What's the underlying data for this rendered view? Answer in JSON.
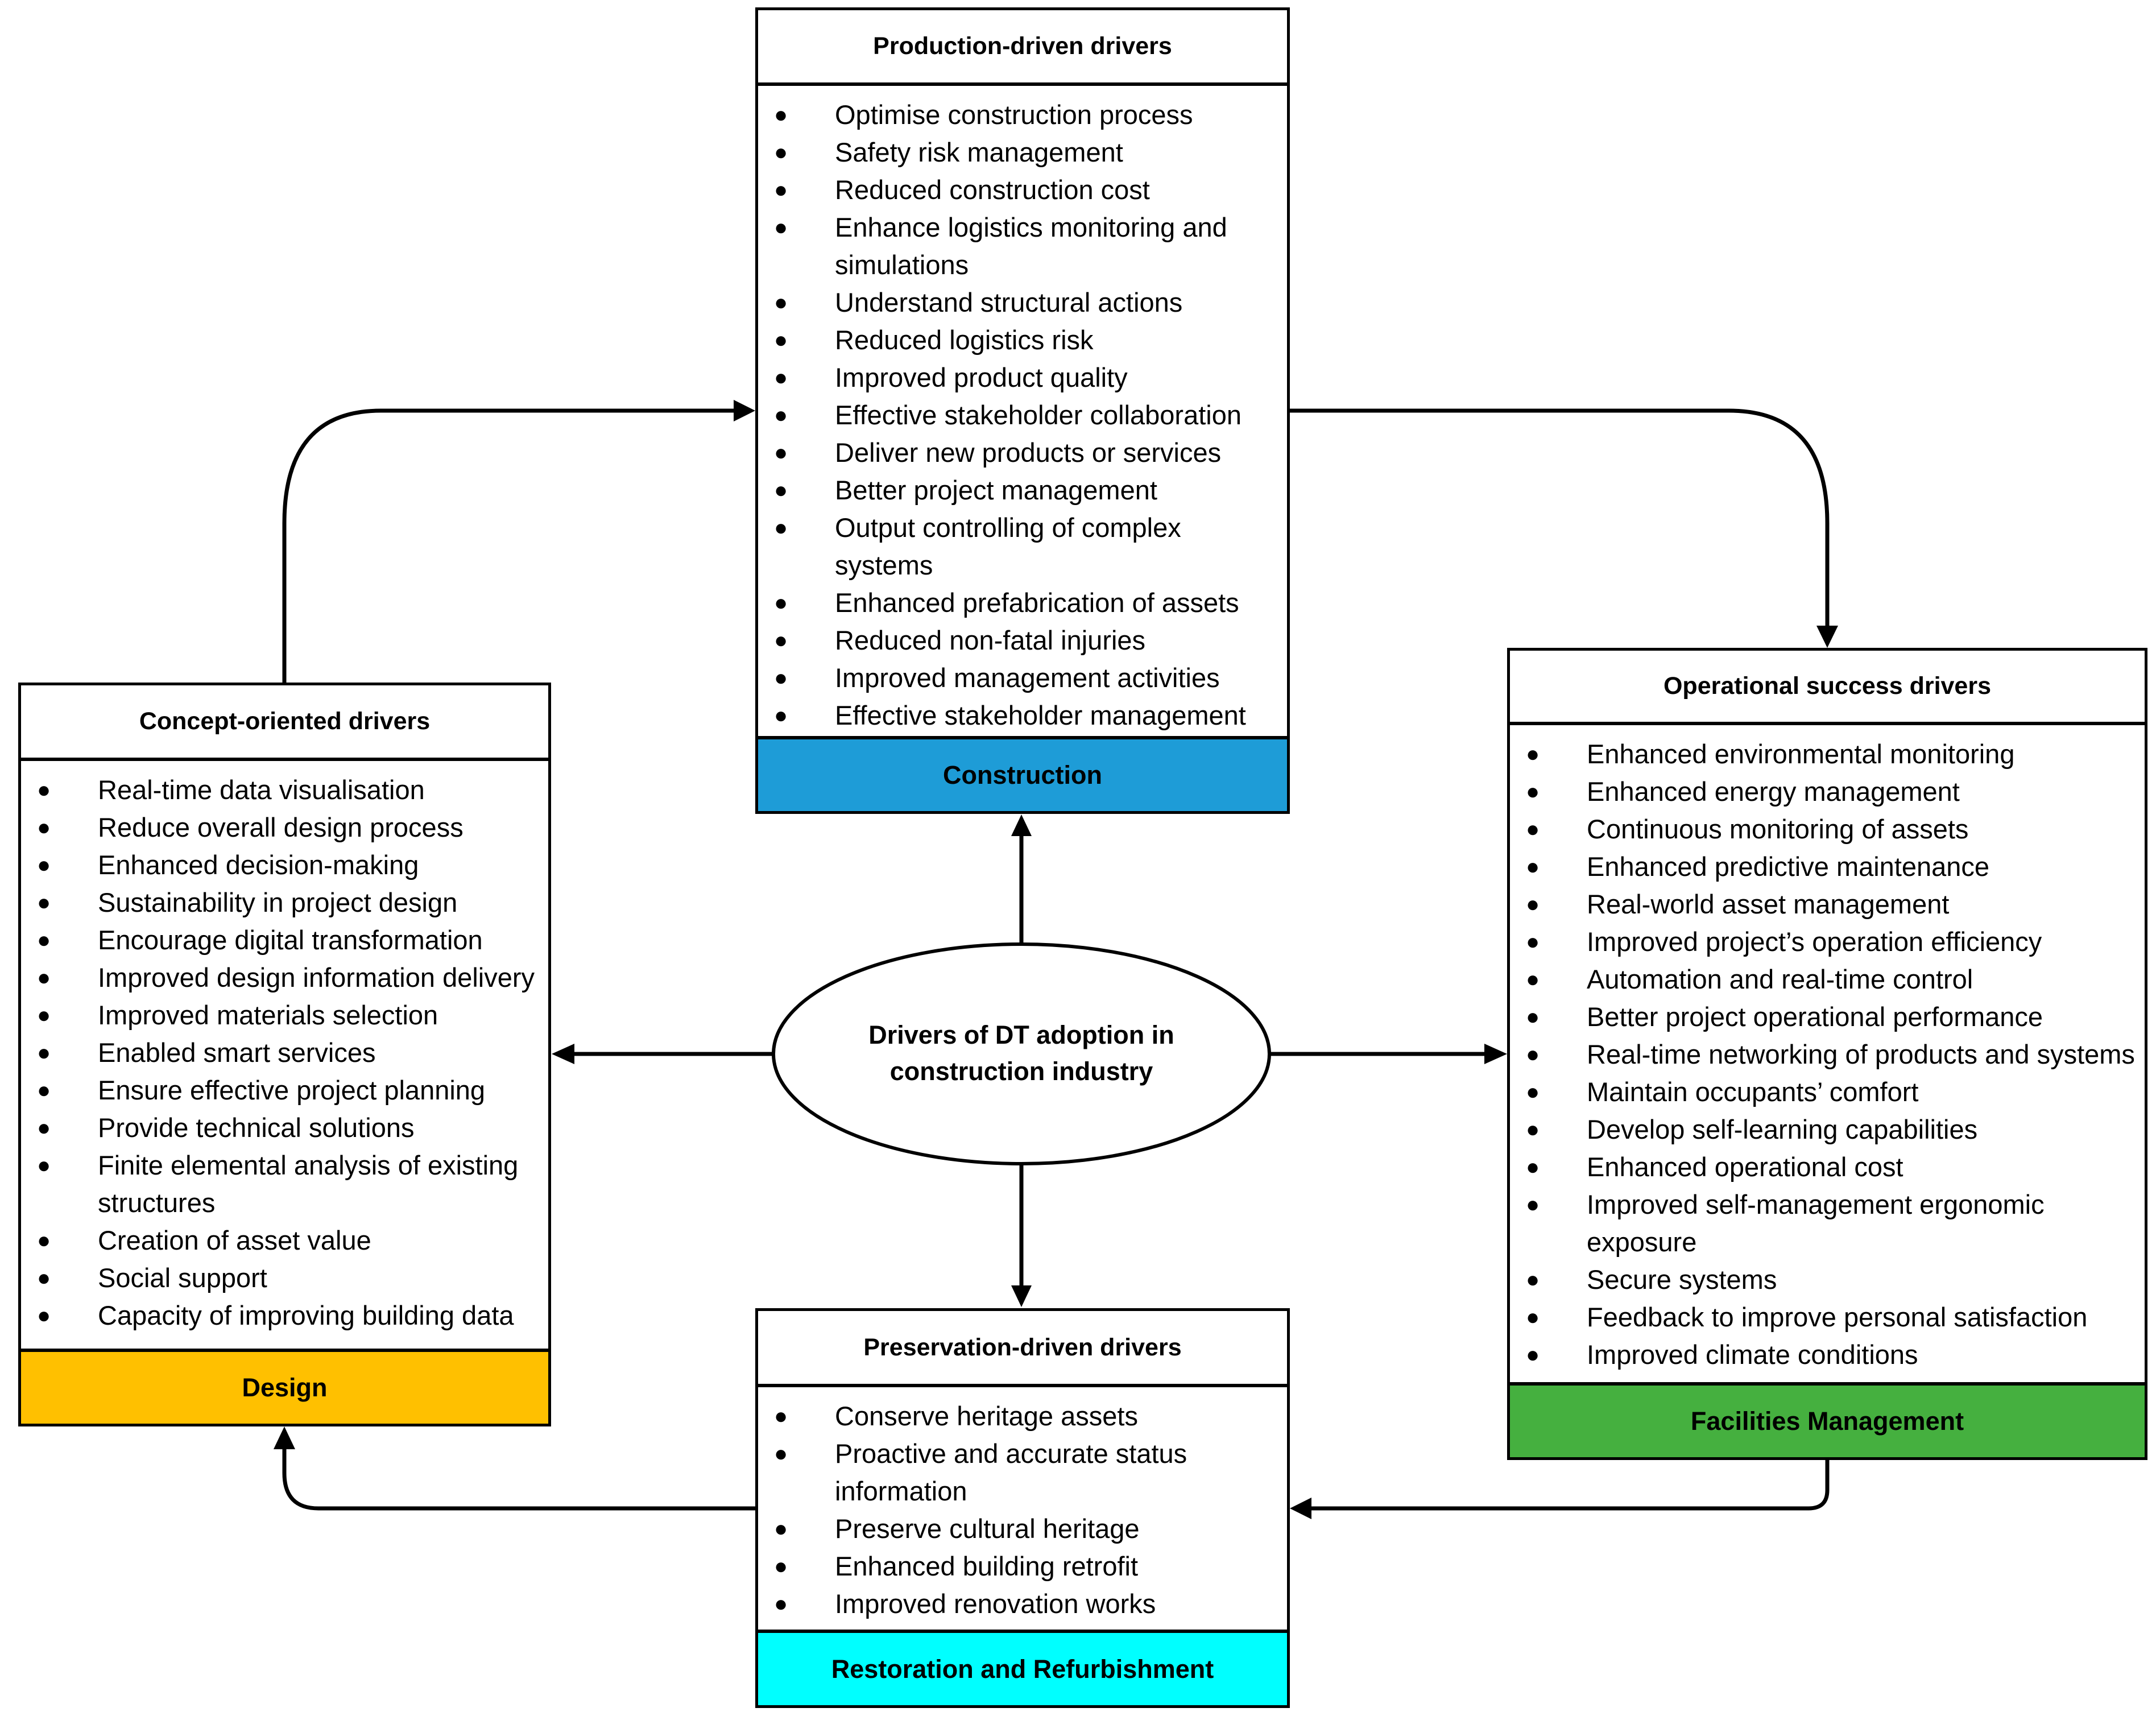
{
  "center": {
    "label": "Drivers of DT adoption in construction industry"
  },
  "colors": {
    "construction": "#1E9CD7",
    "design": "#FFC000",
    "facilities_management": "#45B03F",
    "restoration": "#00FFFF",
    "line": "#000000"
  },
  "boxes": {
    "production": {
      "title": "Production-driven drivers",
      "phase": "Construction",
      "items": [
        "Optimise construction process",
        "Safety risk management",
        "Reduced construction cost",
        "Enhance logistics monitoring and simulations",
        "Understand structural actions",
        "Reduced logistics risk",
        "Improved product quality",
        "Effective stakeholder collaboration",
        "Deliver new products or services",
        "Better project management",
        "Output controlling of complex systems",
        "Enhanced prefabrication of assets",
        "Reduced non-fatal injuries",
        "Improved management activities",
        "Effective stakeholder management"
      ]
    },
    "concept": {
      "title": "Concept-oriented drivers",
      "phase": "Design",
      "items": [
        "Real-time data visualisation",
        "Reduce overall design process",
        "Enhanced decision-making",
        "Sustainability in project design",
        "Encourage digital transformation",
        "Improved design information delivery",
        "Improved materials selection",
        "Enabled smart services",
        "Ensure effective project planning",
        "Provide technical solutions",
        "Finite elemental analysis of existing structures",
        "Creation of asset value",
        "Social support",
        "Capacity of improving building data"
      ]
    },
    "operational": {
      "title": "Operational success drivers",
      "phase": "Facilities Management",
      "items": [
        "Enhanced environmental monitoring",
        "Enhanced energy management",
        "Continuous monitoring of assets",
        "Enhanced predictive maintenance",
        "Real-world asset management",
        "Improved project’s operation efficiency",
        "Automation and real-time control",
        "Better project operational performance",
        "Real-time networking of products and systems",
        "Maintain occupants’ comfort",
        "Develop self-learning capabilities",
        "Enhanced operational cost",
        "Improved self-management ergonomic exposure",
        "Secure systems",
        "Feedback to improve personal satisfaction",
        "Improved climate conditions"
      ]
    },
    "preservation": {
      "title": "Preservation-driven drivers",
      "phase": "Restoration and Refurbishment",
      "items": [
        "Conserve heritage assets",
        "Proactive and accurate status information",
        "Preserve cultural heritage",
        "Enhanced building retrofit",
        "Improved renovation works"
      ]
    }
  },
  "flow": [
    {
      "from": "center",
      "to": "production"
    },
    {
      "from": "center",
      "to": "concept"
    },
    {
      "from": "center",
      "to": "operational"
    },
    {
      "from": "center",
      "to": "preservation"
    },
    {
      "from": "concept",
      "to": "production"
    },
    {
      "from": "production",
      "to": "operational"
    },
    {
      "from": "operational",
      "to": "preservation"
    },
    {
      "from": "preservation",
      "to": "concept"
    }
  ]
}
